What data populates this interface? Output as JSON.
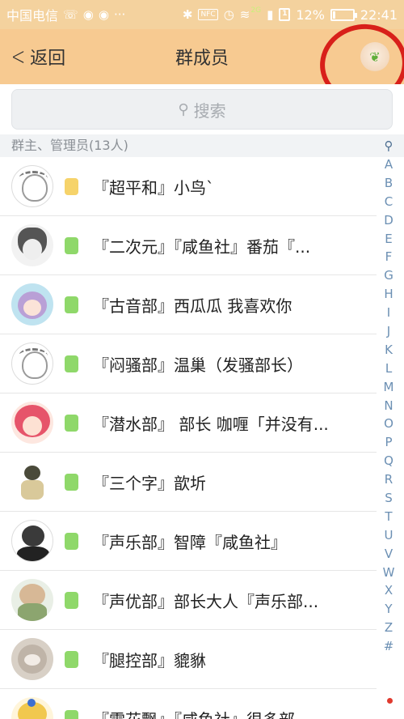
{
  "status_bar": {
    "carrier": "中国电信",
    "signal_label": "2G",
    "battery_percent": "12%",
    "battery_level": 12,
    "time": "22:41",
    "nfc_label": "NFC",
    "sim_label": "1",
    "icons": [
      "missed-call-icon",
      "weibo-icon",
      "weibo-icon",
      "more-icon",
      "bluetooth-icon",
      "nfc-icon",
      "alarm-icon",
      "wifi-icon",
      "signal-icon",
      "sim-icon",
      "battery-icon"
    ]
  },
  "header": {
    "back_label": "返回",
    "title": "群成员",
    "avatar_icon": "sprout-icon"
  },
  "search": {
    "placeholder": "搜索"
  },
  "section": {
    "label": "群主、管理员(13人)"
  },
  "colors": {
    "header_bg": "#f7ca91",
    "level_yellow": "#f6d36a",
    "level_green": "#8fd86a",
    "annotation_red": "#d8201a"
  },
  "members": [
    {
      "name": "『超平和』小鸟ˋ",
      "level_color": "#f6d36a",
      "avatar": "sketch-avatar"
    },
    {
      "name": "『二次元』『咸鱼社』番茄『...",
      "level_color": "#8fd86a",
      "avatar": "dark-hair-avatar"
    },
    {
      "name": "『古音部』西瓜瓜  我喜欢你",
      "level_color": "#8fd86a",
      "avatar": "purple-hair-avatar"
    },
    {
      "name": "『闷骚部』温巢（发骚部长）",
      "level_color": "#8fd86a",
      "avatar": "sketch-avatar"
    },
    {
      "name": "『潜水部』 部长 咖喱「并没有...",
      "level_color": "#8fd86a",
      "avatar": "red-hair-avatar"
    },
    {
      "name": "『三个字』歆圻",
      "level_color": "#8fd86a",
      "avatar": "kid-avatar"
    },
    {
      "name": "『声乐部』智障『咸鱼社』",
      "level_color": "#8fd86a",
      "avatar": "bw-avatar"
    },
    {
      "name": "『声优部』部长大人『声乐部...",
      "level_color": "#8fd86a",
      "avatar": "boy-avatar"
    },
    {
      "name": "『腿控部』貔貅",
      "level_color": "#8fd86a",
      "avatar": "cat-avatar"
    },
    {
      "name": "『雪花飘』『咸鱼社』很多部",
      "level_color": "#8fd86a",
      "avatar": "blonde-avatar"
    }
  ],
  "index_bar": {
    "search_icon": "search-icon",
    "letters": [
      "A",
      "B",
      "C",
      "D",
      "E",
      "F",
      "G",
      "H",
      "I",
      "J",
      "K",
      "L",
      "M",
      "N",
      "O",
      "P",
      "Q",
      "R",
      "S",
      "T",
      "U",
      "V",
      "W",
      "X",
      "Y",
      "Z",
      "#"
    ]
  }
}
